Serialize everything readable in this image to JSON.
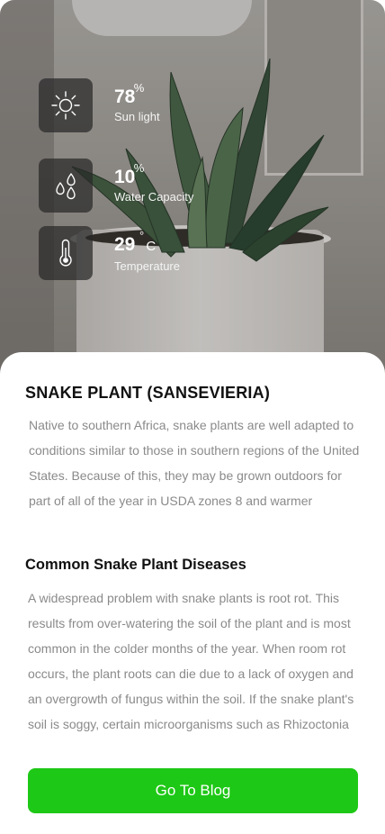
{
  "stats": [
    {
      "value": "78",
      "unit": "%",
      "label": "Sun light",
      "icon": "sun-icon"
    },
    {
      "value": "10",
      "unit": "%",
      "label": "Water Capacity",
      "icon": "water-drops-icon"
    },
    {
      "value": "29",
      "unit": "°",
      "unit_suffix": "C",
      "label": "Temperature",
      "icon": "thermometer-icon"
    }
  ],
  "plant": {
    "title": "SNAKE PLANT (SANSEVIERIA)",
    "description": "Native to southern Africa, snake plants are well adapted to conditions similar to those in southern regions of the United States. Because of this, they may be grown outdoors for part of all of the year in USDA zones 8 and warmer",
    "diseases_title": "Common Snake Plant Diseases",
    "diseases_text": "A widespread problem with snake plants is root rot. This results from over-watering the soil of the plant and is most common in the colder months of the year. When room rot occurs, the plant roots can die due to a lack of oxygen and an overgrowth of fungus within the soil. If the snake plant's soil is soggy, certain microorganisms such as Rhizoctonia"
  },
  "cta": {
    "label": "Go To Blog"
  },
  "colors": {
    "accent": "#1ec816",
    "tile": "#282828",
    "body_text": "#8a8a8a"
  }
}
